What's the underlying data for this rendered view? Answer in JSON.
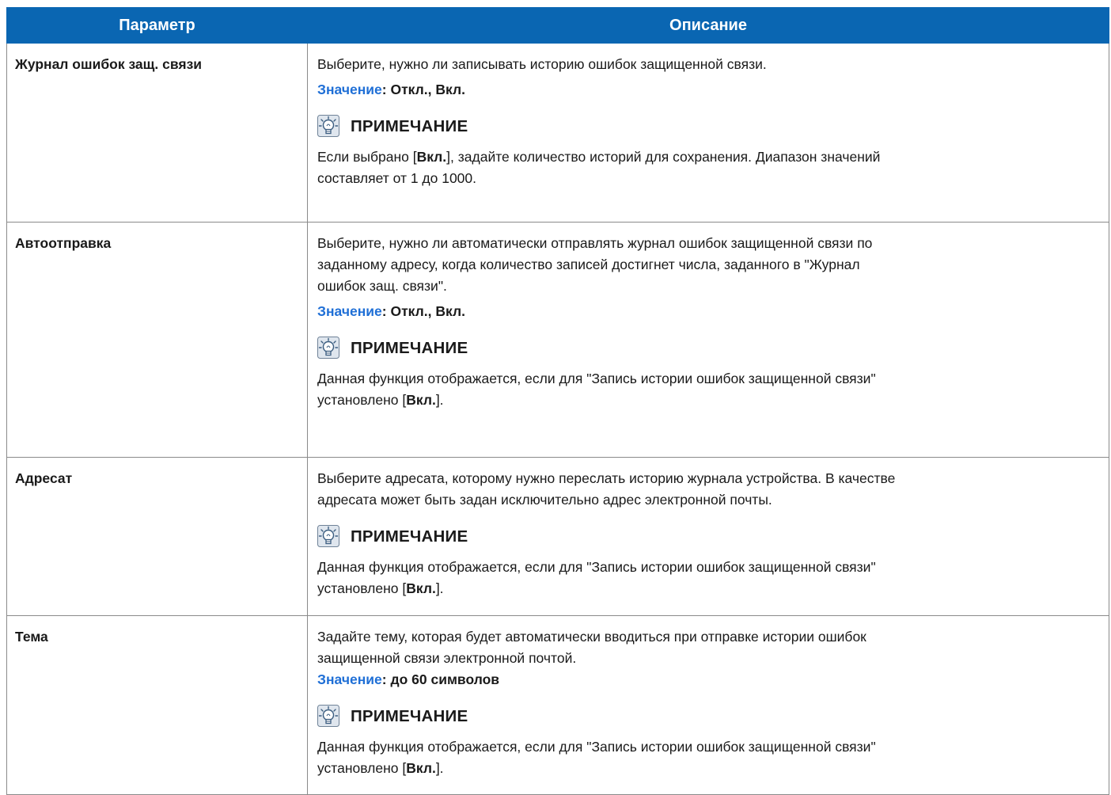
{
  "header": {
    "col_param": "Параметр",
    "col_desc": "Описание"
  },
  "note_title": "ПРИМЕЧАНИЕ",
  "rows": [
    {
      "param": "Журнал ошибок защ. связи",
      "desc_lines": [
        "Выберите, нужно ли записывать историю ошибок защищенной связи."
      ],
      "value_label": "Значение",
      "value_text": ": Откл., Вкл.",
      "note_pre": "Если выбрано [",
      "note_bold": "Вкл.",
      "note_post_lines": [
        "], задайте количество историй для сохранения. Диапазон значений",
        "составляет от 1 до 1000."
      ]
    },
    {
      "param": "Автоотправка",
      "desc_lines": [
        "Выберите, нужно ли автоматически отправлять журнал ошибок защищенной связи по",
        "заданному адресу, когда количество записей достигнет числа, заданного в \"Журнал",
        "ошибок защ. связи\"."
      ],
      "value_label": "Значение",
      "value_text": ": Откл., Вкл.",
      "note_lines": [
        "Данная функция отображается, если для \"Запись истории ошибок защищенной связи\""
      ],
      "note_line2_pre": "установлено [",
      "note_bold": "Вкл.",
      "note_line2_post": "]."
    },
    {
      "param": "Адресат",
      "desc_lines": [
        "Выберите адресата, которому нужно переслать историю журнала устройства. В качестве",
        "адресата может быть задан исключительно адрес электронной почты."
      ],
      "note_lines": [
        "Данная функция отображается, если для \"Запись истории ошибок защищенной связи\""
      ],
      "note_line2_pre": "установлено [",
      "note_bold": "Вкл.",
      "note_line2_post": "]."
    },
    {
      "param": "Тема",
      "desc_lines": [
        "Задайте тему, которая будет автоматически вводиться при отправке истории ошибок",
        "защищенной связи электронной почтой."
      ],
      "value_label": "Значение",
      "value_text": ": до 60 символов",
      "note_lines": [
        "Данная функция отображается, если для \"Запись истории ошибок защищенной связи\""
      ],
      "note_line2_pre": "установлено [",
      "note_bold": "Вкл.",
      "note_line2_post": "]."
    }
  ]
}
